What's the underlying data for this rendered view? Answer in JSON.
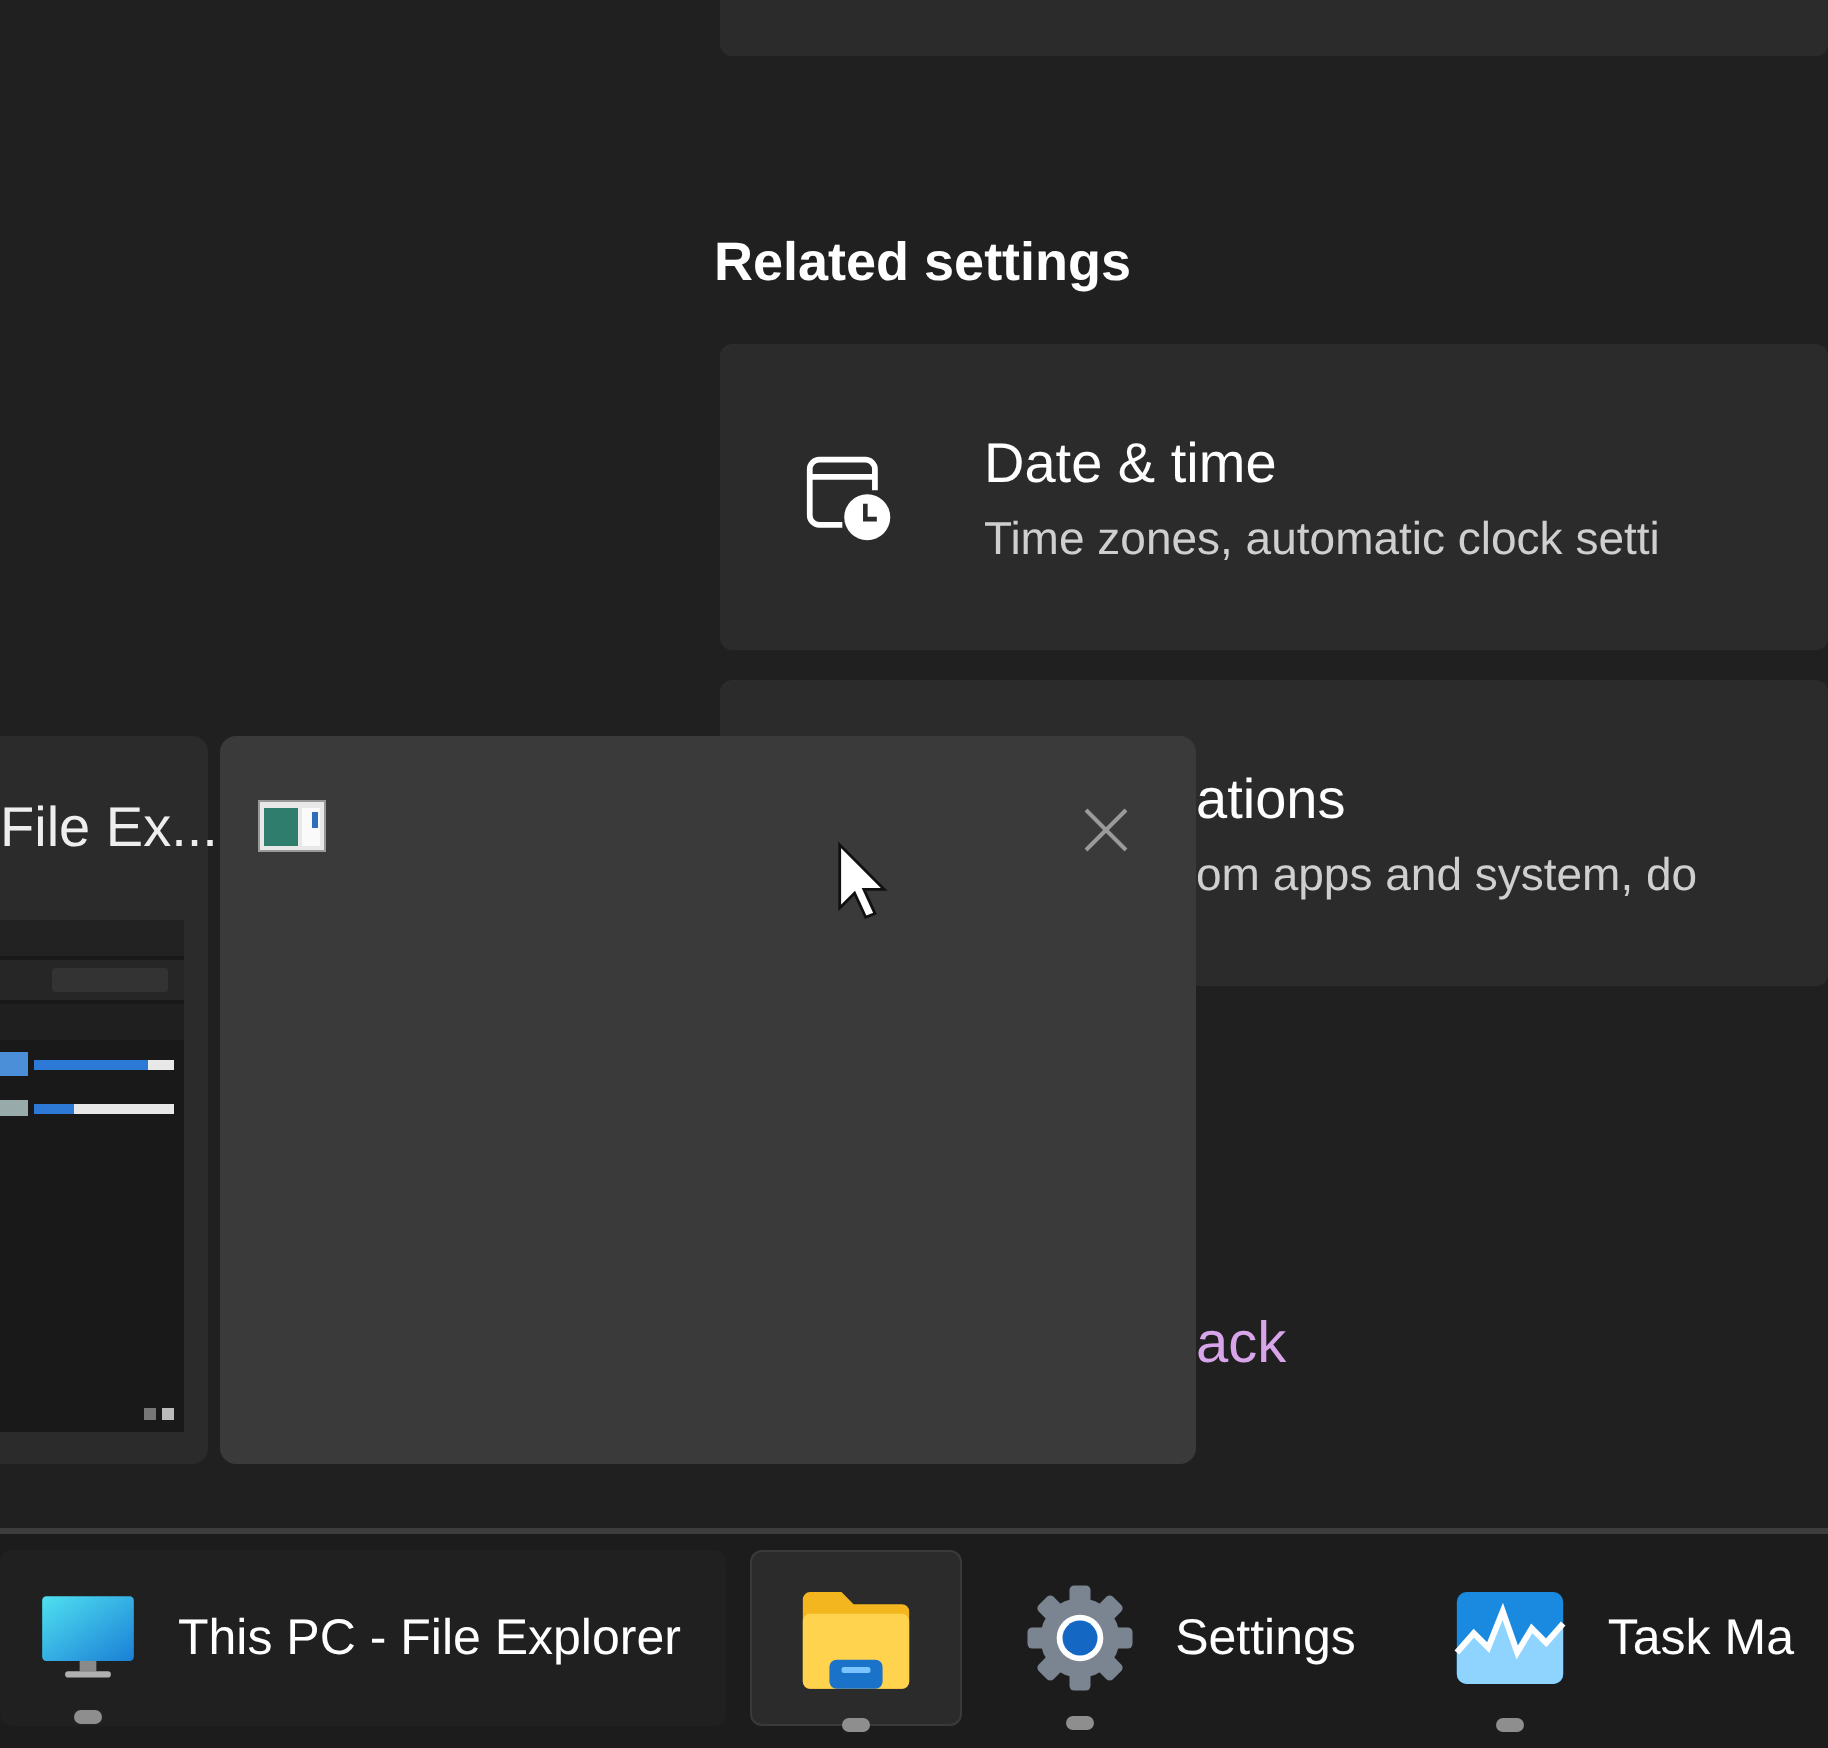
{
  "settings": {
    "section_heading": "Related settings",
    "cards": [
      {
        "kind": "date-time",
        "title": "Date & time",
        "description": "Time zones, automatic clock setti"
      },
      {
        "kind": "covered",
        "title": "ations",
        "description": "om apps and system, do"
      }
    ],
    "link": "ack"
  },
  "previews": {
    "side_title": "File Ex...",
    "main": {
      "kind": "settings-window"
    }
  },
  "taskbar": {
    "items": [
      {
        "kind": "monitor",
        "label": "This PC - File Explorer",
        "selected": false,
        "hovered": true,
        "running": true
      },
      {
        "kind": "folder",
        "selected": true,
        "hovered": false,
        "running": true
      },
      {
        "kind": "gear",
        "label": "Settings",
        "selected": false,
        "hovered": false,
        "running": true
      },
      {
        "kind": "monitor-chart",
        "label": "Task Ma",
        "selected": false,
        "hovered": false,
        "running": true
      }
    ]
  }
}
